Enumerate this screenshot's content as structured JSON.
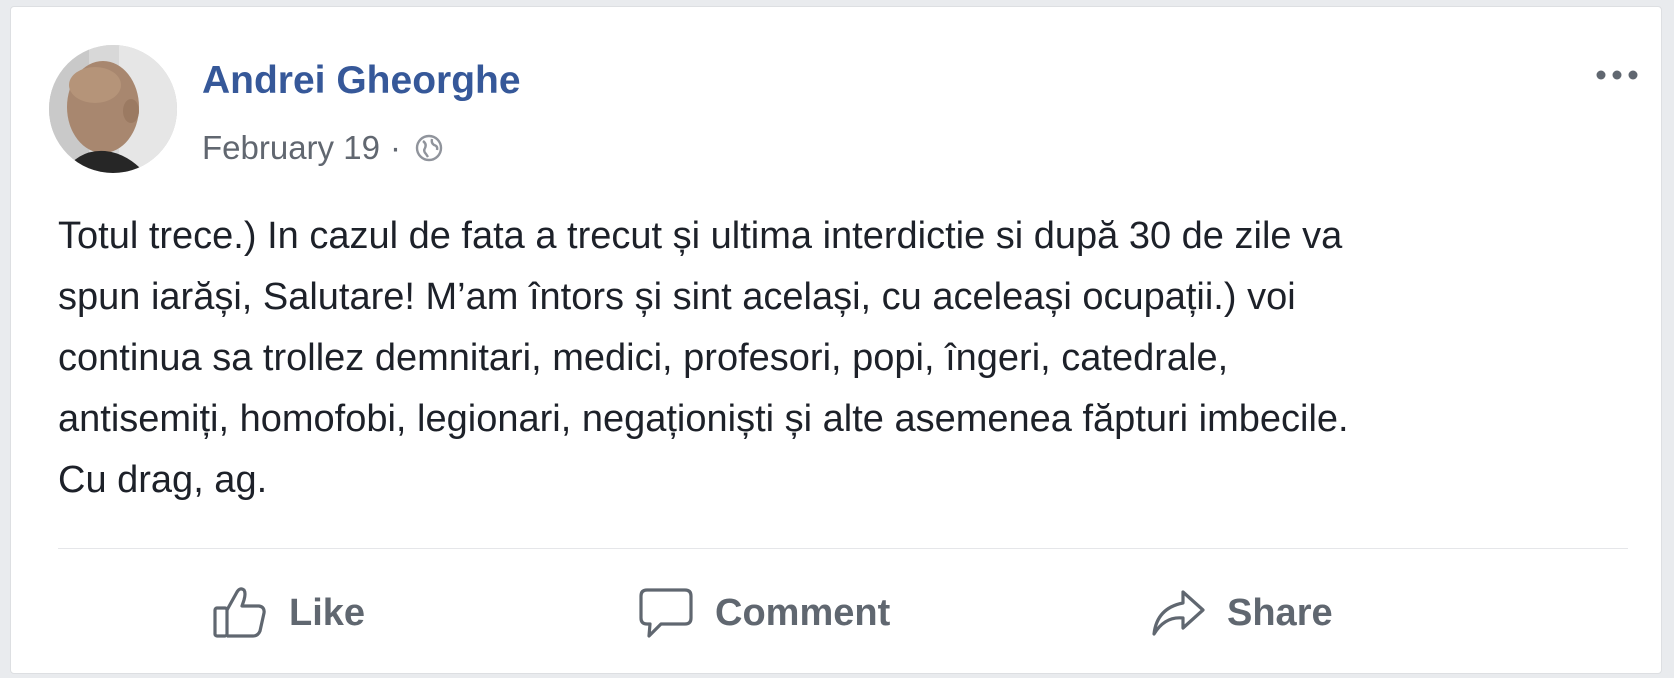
{
  "post": {
    "author": "Andrei Gheorghe",
    "date": "February 19",
    "separator": "·",
    "privacy_icon": "globe-icon",
    "more_icon": "more-options-icon",
    "text_lines": [
      "Totul trece.) In cazul de fata a trecut și ultima interdictie si după 30 de zile va",
      "spun iarăși, Salutare! M’am întors și sint același, cu aceleași ocupații.) voi",
      "continua sa trollez demnitari, medici, profesori, popi, îngeri, catedrale,",
      "antisemiți, homofobi, legionari, negaționiști și alte asemenea făpturi imbecile.",
      "Cu drag, ag."
    ]
  },
  "actions": {
    "like_label": "Like",
    "comment_label": "Comment",
    "share_label": "Share",
    "like_icon": "thumbs-up-icon",
    "comment_icon": "speech-bubble-icon",
    "share_icon": "share-arrow-icon"
  },
  "colors": {
    "author_link": "#365899",
    "body_text": "#1d2129",
    "meta_text": "#616770",
    "action_text": "#606770",
    "card_background": "#ffffff",
    "page_background": "#e9ebee"
  }
}
